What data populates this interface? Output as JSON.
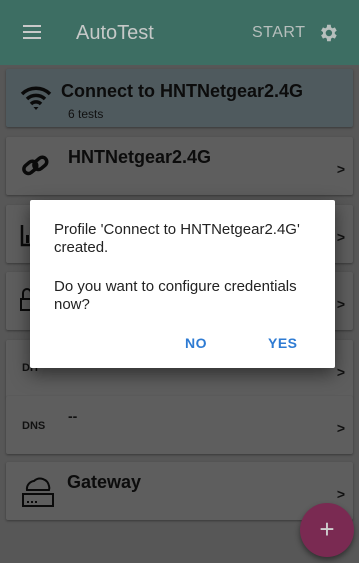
{
  "appbar": {
    "title": "AutoTest",
    "start_label": "START",
    "menu_icon": "hamburger-menu-icon",
    "settings_icon": "gear-icon"
  },
  "cards": [
    {
      "title": "Connect to HNTNetgear2.4G",
      "subtitle": "6 tests",
      "icon": "wifi-icon"
    },
    {
      "title": "HNTNetgear2.4G",
      "icon": "link-icon"
    },
    {
      "icon": "bar-chart-icon"
    },
    {
      "icon": "lock-icon"
    },
    {
      "tag": "DH"
    },
    {
      "tag": "DNS",
      "value": "--"
    },
    {
      "title": "Gateway",
      "icon": "router-icon"
    }
  ],
  "chevron": ">",
  "dialog": {
    "message_line1": "Profile 'Connect to HNTNetgear2.4G' created.",
    "message_line2": "Do you want to configure credentials now?",
    "no_label": "NO",
    "yes_label": "YES"
  },
  "fab": {
    "label": "+"
  },
  "colors": {
    "appbar": "#3d6e63",
    "accent_button_text": "#2e7bd3",
    "fab": "#7a2a52"
  }
}
